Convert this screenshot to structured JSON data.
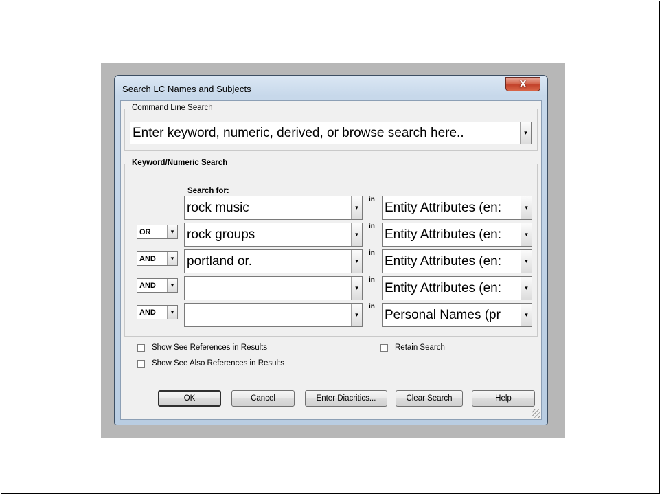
{
  "window": {
    "title": "Search LC Names and Subjects",
    "close_glyph": "X"
  },
  "command_line": {
    "legend": "Command Line Search",
    "placeholder": "Enter keyword, numeric, derived, or browse search here..",
    "dropdown_glyph": "▾"
  },
  "keyword": {
    "legend": "Keyword/Numeric Search",
    "search_for_label": "Search for:",
    "in_label": "in",
    "rows": [
      {
        "operator": "",
        "term": "rock music",
        "index": "Entity Attributes (en:"
      },
      {
        "operator": "OR",
        "term": "rock groups",
        "index": "Entity Attributes (en:"
      },
      {
        "operator": "AND",
        "term": "portland or.",
        "index": "Entity Attributes (en:"
      },
      {
        "operator": "AND",
        "term": "",
        "index": "Entity Attributes (en:"
      },
      {
        "operator": "AND",
        "term": "",
        "index": "Personal Names (pr"
      }
    ]
  },
  "options": {
    "show_see_refs": "Show See References in Results",
    "show_see_also_refs": "Show See Also References in Results",
    "retain_search": "Retain Search"
  },
  "buttons": {
    "ok": "OK",
    "cancel": "Cancel",
    "diacritics": "Enter Diacritics...",
    "clear": "Clear Search",
    "help": "Help"
  },
  "colors": {
    "close_button": "#c2412a",
    "window_frame": "#c7d8ea",
    "client_bg": "#f0f0f0"
  }
}
